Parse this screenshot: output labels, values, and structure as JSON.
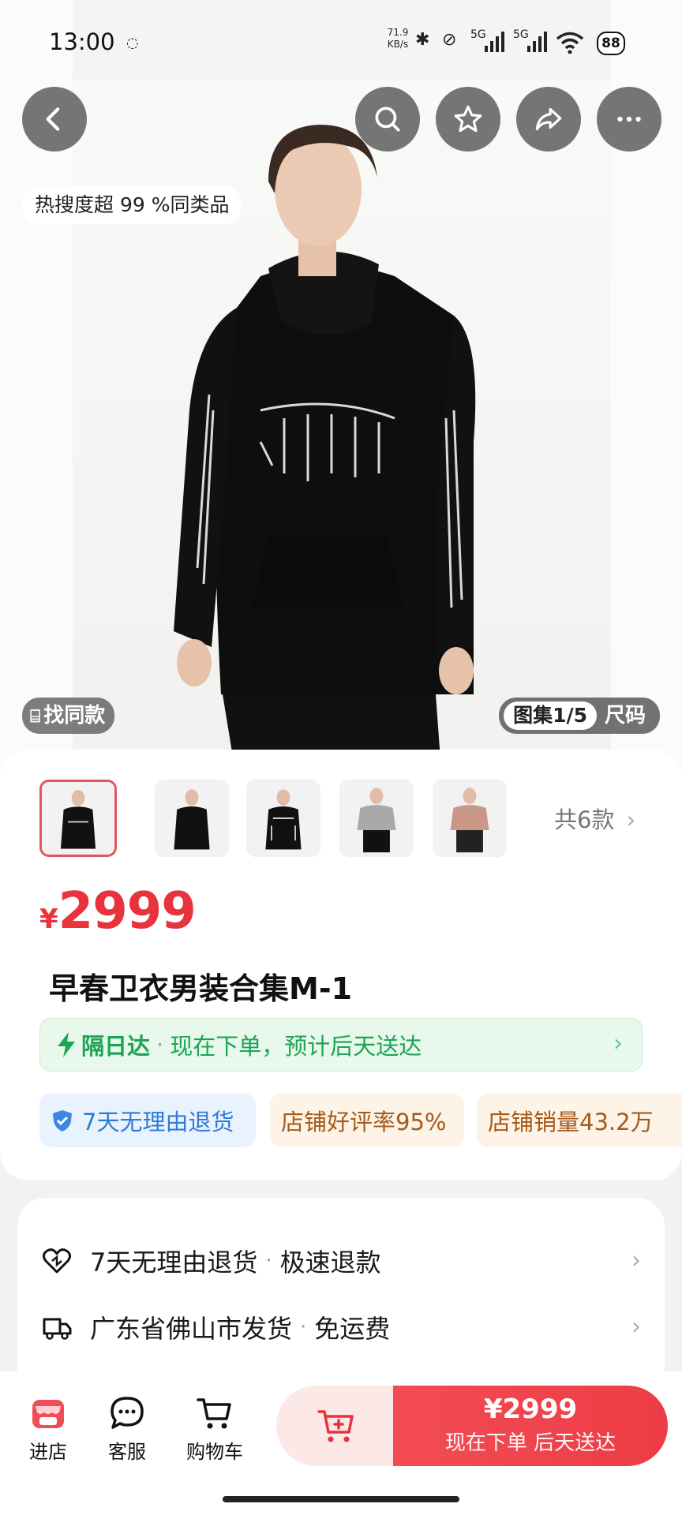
{
  "status_bar": {
    "time": "13:00",
    "net_speed_value": "71.9",
    "net_speed_unit": "KB/s",
    "signal1": "5G",
    "signal2": "5G",
    "battery": "88"
  },
  "hero": {
    "heat_label": "热搜度超 99 %同类品",
    "find_same_label": "找同款",
    "gallery_counter": "图集1/5",
    "size_label": "尺码"
  },
  "top_actions": [
    "back",
    "search",
    "favorite",
    "share",
    "more"
  ],
  "thumbnails": {
    "items": [
      "black-print-front",
      "black-plain",
      "black-print",
      "grey-hoodie",
      "pink-hoodie"
    ],
    "active_index": 0,
    "variant_count_label": "共6款"
  },
  "product": {
    "currency": "¥",
    "price": "2999",
    "title": "早春卫衣男装合集M-1"
  },
  "delivery": {
    "label": "隔日达",
    "detail": "现在下单，预计后天送达"
  },
  "tags": {
    "return": "7天无理由退货",
    "rating": "店铺好评率95%",
    "sales": "店铺销量43.2万"
  },
  "services": [
    {
      "main": "7天无理由退货",
      "extra": "极速退款"
    },
    {
      "main": "广东省佛山市发货",
      "extra": "免运费"
    }
  ],
  "bottom_bar": {
    "shop": "进店",
    "service": "客服",
    "cart": "购物车",
    "buy_price": "¥2999",
    "buy_sub": "现在下单  后天送达"
  },
  "colors": {
    "price_red": "#e8333c",
    "green": "#1da453",
    "blue": "#2f7ad8",
    "orange": "#a55a1c"
  }
}
